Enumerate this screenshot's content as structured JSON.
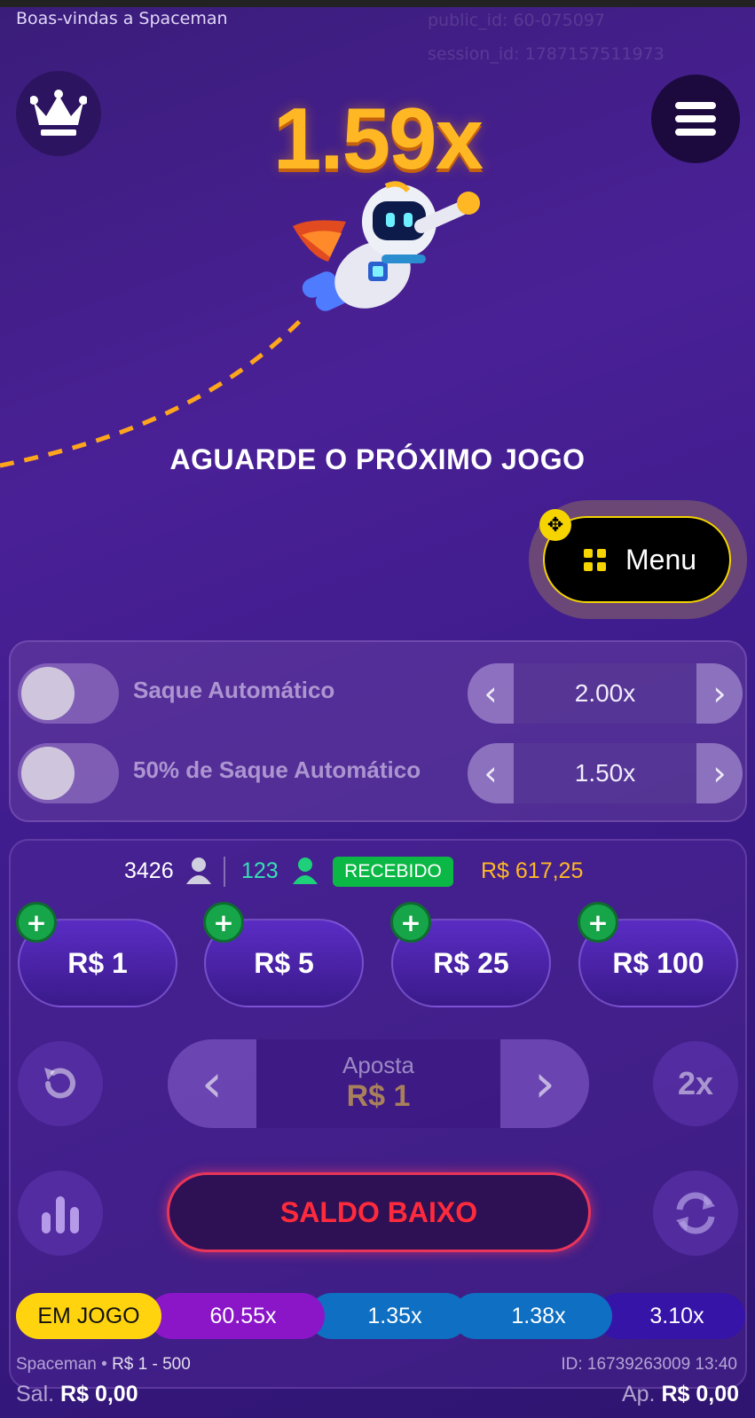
{
  "header": {
    "welcome": "Boas-vindas a Spaceman",
    "public_id": "public_id: 60-075097",
    "session_id": "session_id: 1787157511973"
  },
  "game": {
    "multiplier": "1.59x",
    "status": "AGUARDE O PRÓXIMO JOGO"
  },
  "float_menu": {
    "label": "Menu"
  },
  "auto": {
    "row1": {
      "label": "Saque Automático",
      "value": "2.00x"
    },
    "row2": {
      "label": "50% de Saque Automático",
      "value": "1.50x"
    }
  },
  "stats": {
    "players": "3426",
    "winners": "123",
    "badge": "RECEBIDO",
    "amount": "R$ 617,25"
  },
  "chips": [
    "R$ 1",
    "R$ 5",
    "R$ 25",
    "R$ 100"
  ],
  "bet": {
    "label": "Aposta",
    "value": "R$ 1",
    "double_label": "2x",
    "action": "SALDO BAIXO"
  },
  "history": {
    "current": "EM JOGO",
    "items": [
      "60.55x",
      "1.35x",
      "1.38x",
      "3.10x"
    ]
  },
  "footer": {
    "game_name": "Spaceman",
    "limits": "R$ 1 - 500",
    "id": "ID: 16739263009 13:40",
    "balance_label": "Sal.",
    "balance": "R$ 0,00",
    "bet_label": "Ap.",
    "bet_amount": "R$ 0,00"
  },
  "colors": {
    "accent": "#ffb824",
    "menu_border": "#f5d400",
    "success": "#0cb845",
    "danger": "#ff2b3c"
  }
}
